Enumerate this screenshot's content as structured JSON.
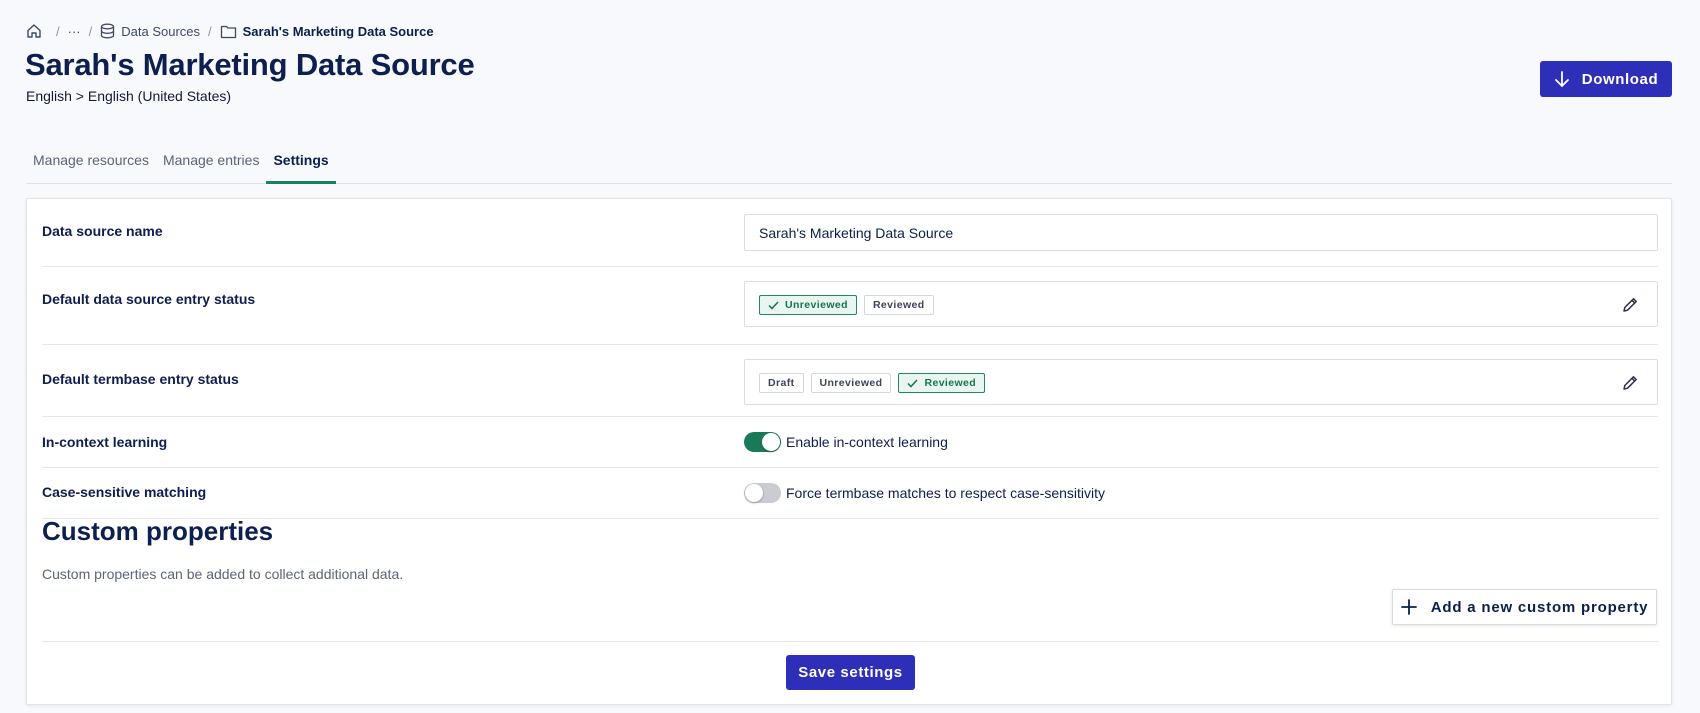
{
  "breadcrumb": {
    "ellipsis": "···",
    "data_sources": "Data Sources",
    "current": "Sarah's Marketing Data Source"
  },
  "header": {
    "title": "Sarah's Marketing Data Source",
    "locale": "English > English (United States)",
    "download_label": "Download"
  },
  "tabs": [
    {
      "label": "Manage resources"
    },
    {
      "label": "Manage entries"
    },
    {
      "label": "Settings"
    }
  ],
  "settings": {
    "name": {
      "label": "Data source name",
      "value": "Sarah's Marketing Data Source"
    },
    "default_entry_status": {
      "label": "Default data source entry status",
      "options": [
        "Unreviewed",
        "Reviewed"
      ],
      "selected": "Unreviewed"
    },
    "default_termbase_status": {
      "label": "Default termbase entry status",
      "options": [
        "Draft",
        "Unreviewed",
        "Reviewed"
      ],
      "selected": "Reviewed"
    },
    "in_context": {
      "label": "In-context learning",
      "toggle_label": "Enable in-context learning",
      "enabled": true
    },
    "case_sensitive": {
      "label": "Case-sensitive matching",
      "toggle_label": "Force termbase matches to respect case-sensitivity",
      "enabled": false
    }
  },
  "custom_properties": {
    "title": "Custom properties",
    "description": "Custom properties can be added to collect additional data.",
    "add_label": "Add a new custom property"
  },
  "save_label": "Save settings",
  "colors": {
    "primary": "#2e2fb8",
    "accent_green": "#17835e",
    "heading": "#0d1f4f"
  }
}
